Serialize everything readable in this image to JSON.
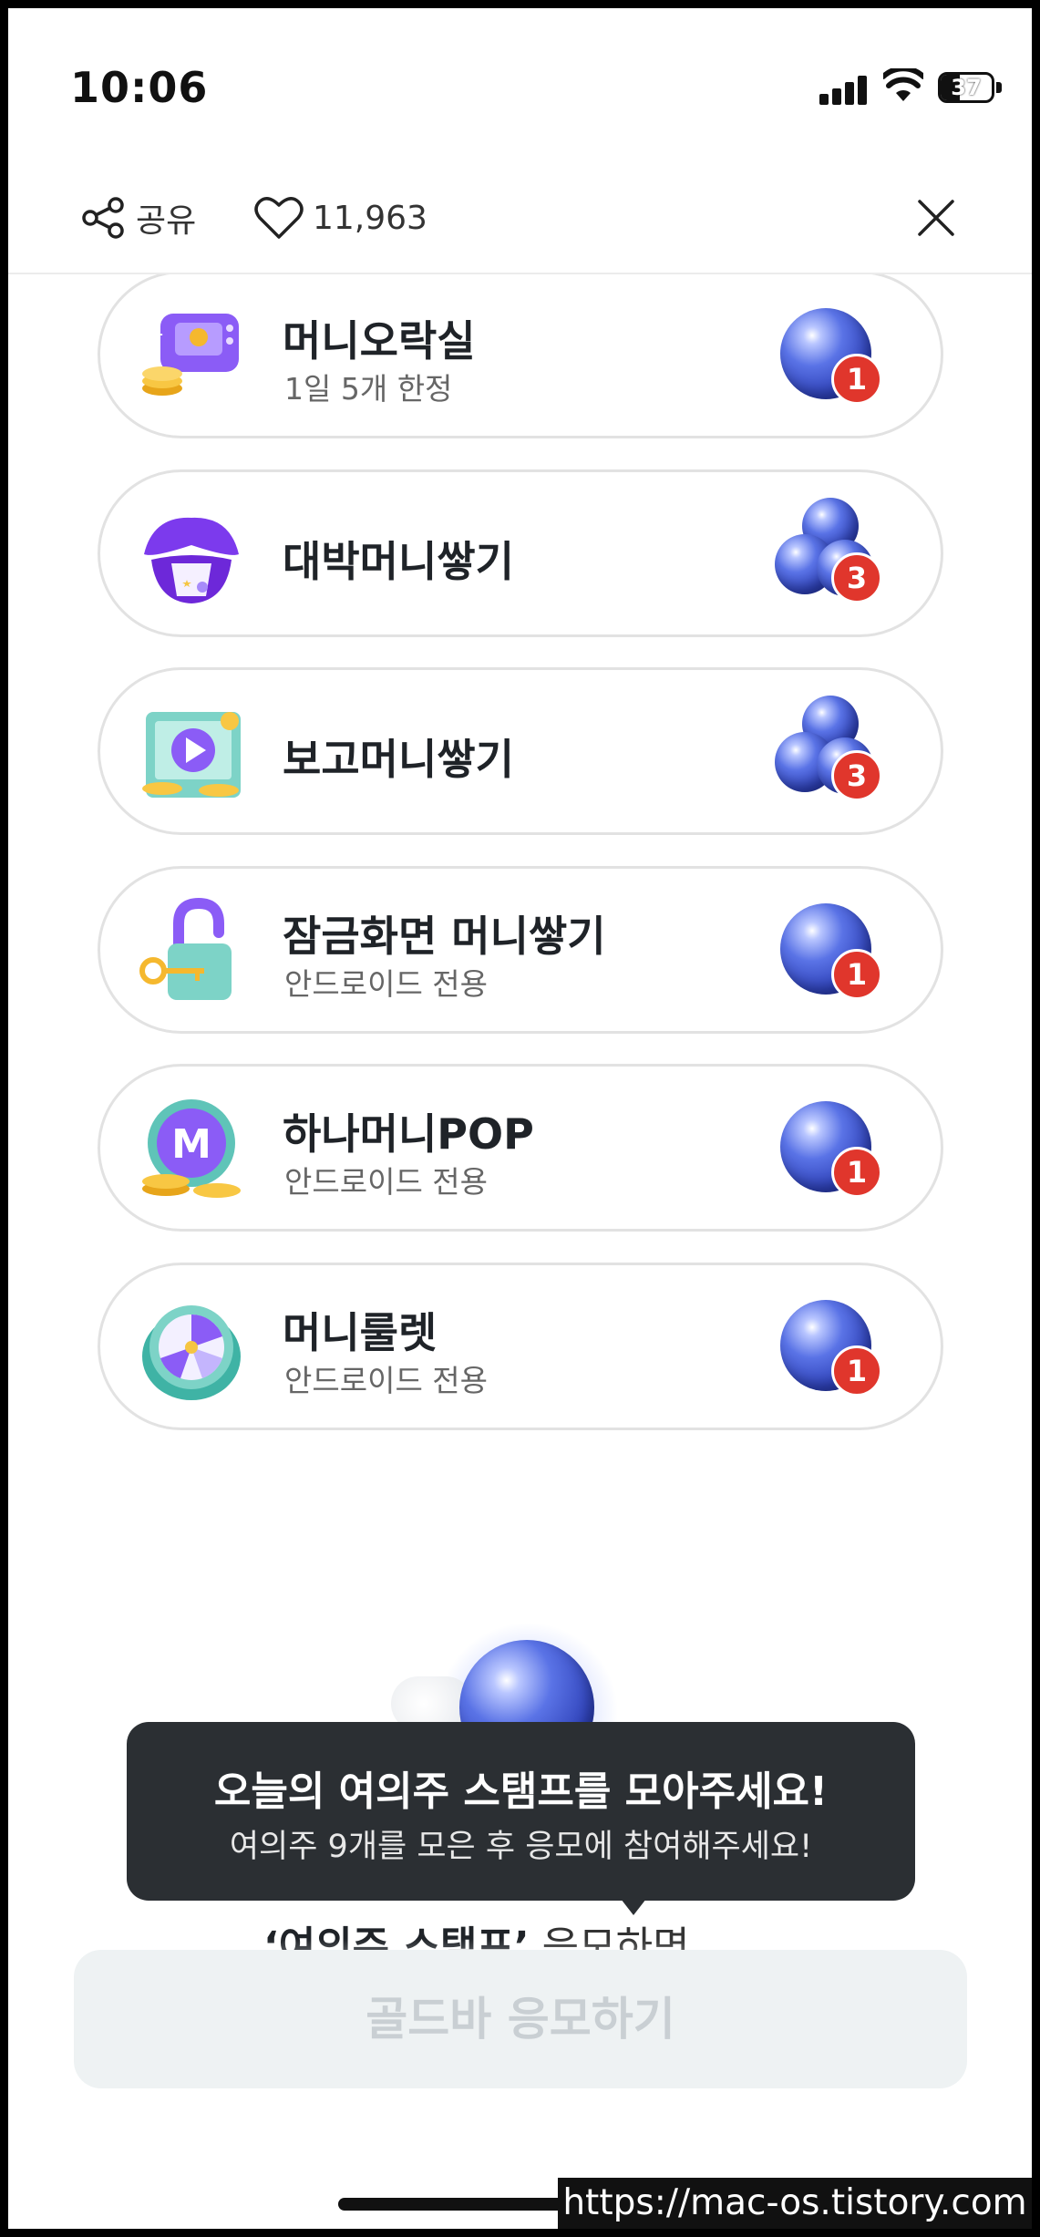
{
  "status": {
    "time": "10:06",
    "battery": "37"
  },
  "header": {
    "share_label": "공유",
    "like_count": "11,963"
  },
  "missions": [
    {
      "title": "머니오락실",
      "subtitle": "1일 5개 한정",
      "reward": "1"
    },
    {
      "title": "대박머니쌓기",
      "subtitle": "",
      "reward": "3"
    },
    {
      "title": "보고머니쌓기",
      "subtitle": "",
      "reward": "3"
    },
    {
      "title": "잠금화면 머니쌓기",
      "subtitle": "안드로이드 전용",
      "reward": "1"
    },
    {
      "title": "하나머니POP",
      "subtitle": "안드로이드 전용",
      "reward": "1"
    },
    {
      "title": "머니룰렛",
      "subtitle": "안드로이드 전용",
      "reward": "1"
    }
  ],
  "tooltip": {
    "title": "오늘의 여의주 스탬프를 모아주세요!",
    "body": "여의주 9개를 모은 후 응모에 참여해주세요!"
  },
  "behind": {
    "bold": "‘여의주 스탬프’",
    "rest": " 응모하면"
  },
  "cta": {
    "label": "골드바 응모하기"
  },
  "watermark": "https://mac-os.tistory.com",
  "colors": {
    "badge": "#e0362c",
    "orb": "#3b52c9",
    "tooltip_bg": "#2b2f33",
    "cta_bg": "#eef2f3"
  }
}
